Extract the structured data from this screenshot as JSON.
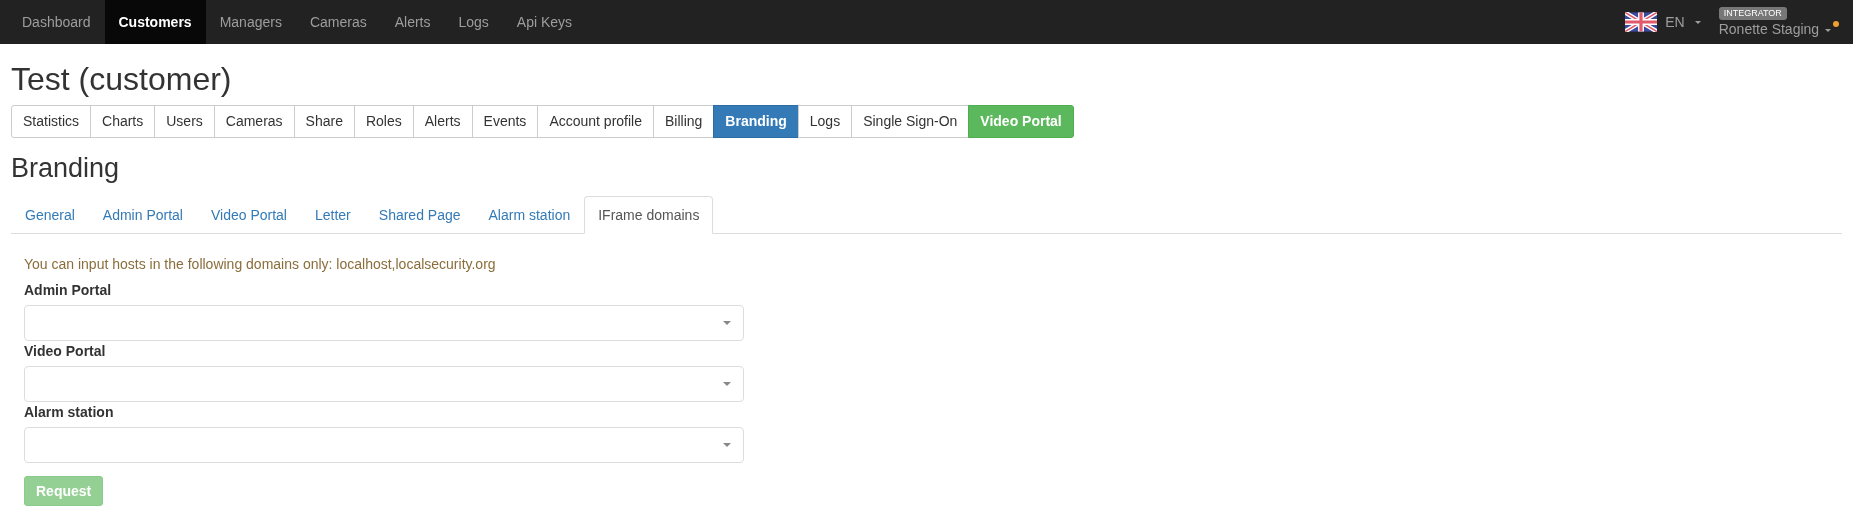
{
  "navbar": {
    "items": [
      {
        "label": "Dashboard",
        "selected": false
      },
      {
        "label": "Customers",
        "selected": true
      },
      {
        "label": "Managers",
        "selected": false
      },
      {
        "label": "Cameras",
        "selected": false
      },
      {
        "label": "Alerts",
        "selected": false
      },
      {
        "label": "Logs",
        "selected": false
      },
      {
        "label": "Api Keys",
        "selected": false
      }
    ],
    "language": "EN",
    "role_badge": "INTEGRATOR",
    "user": "Ronette Staging",
    "notification_dot": true
  },
  "title": "Test (customer)",
  "section_tabs": [
    {
      "label": "Statistics",
      "selected": false,
      "kind": "default"
    },
    {
      "label": "Charts",
      "selected": false,
      "kind": "default"
    },
    {
      "label": "Users",
      "selected": false,
      "kind": "default"
    },
    {
      "label": "Cameras",
      "selected": false,
      "kind": "default"
    },
    {
      "label": "Share",
      "selected": false,
      "kind": "default"
    },
    {
      "label": "Roles",
      "selected": false,
      "kind": "default"
    },
    {
      "label": "Alerts",
      "selected": false,
      "kind": "default"
    },
    {
      "label": "Events",
      "selected": false,
      "kind": "default"
    },
    {
      "label": "Account profile",
      "selected": false,
      "kind": "default"
    },
    {
      "label": "Billing",
      "selected": false,
      "kind": "default"
    },
    {
      "label": "Branding",
      "selected": true,
      "kind": "default"
    },
    {
      "label": "Logs",
      "selected": false,
      "kind": "default"
    },
    {
      "label": "Single Sign-On",
      "selected": false,
      "kind": "default"
    },
    {
      "label": "Video Portal",
      "selected": false,
      "kind": "success"
    }
  ],
  "heading": "Branding",
  "branding_tabs": [
    {
      "label": "General",
      "selected": false
    },
    {
      "label": "Admin Portal",
      "selected": false
    },
    {
      "label": "Video Portal",
      "selected": false
    },
    {
      "label": "Letter",
      "selected": false
    },
    {
      "label": "Shared Page",
      "selected": false
    },
    {
      "label": "Alarm station",
      "selected": false
    },
    {
      "label": "IFrame domains",
      "selected": true
    }
  ],
  "note": "You can input hosts in the following domains only: localhost,localsecurity.org",
  "fields": [
    {
      "label": "Admin Portal"
    },
    {
      "label": "Video Portal"
    },
    {
      "label": "Alarm station"
    }
  ],
  "request_button": {
    "label": "Request",
    "disabled": true
  }
}
